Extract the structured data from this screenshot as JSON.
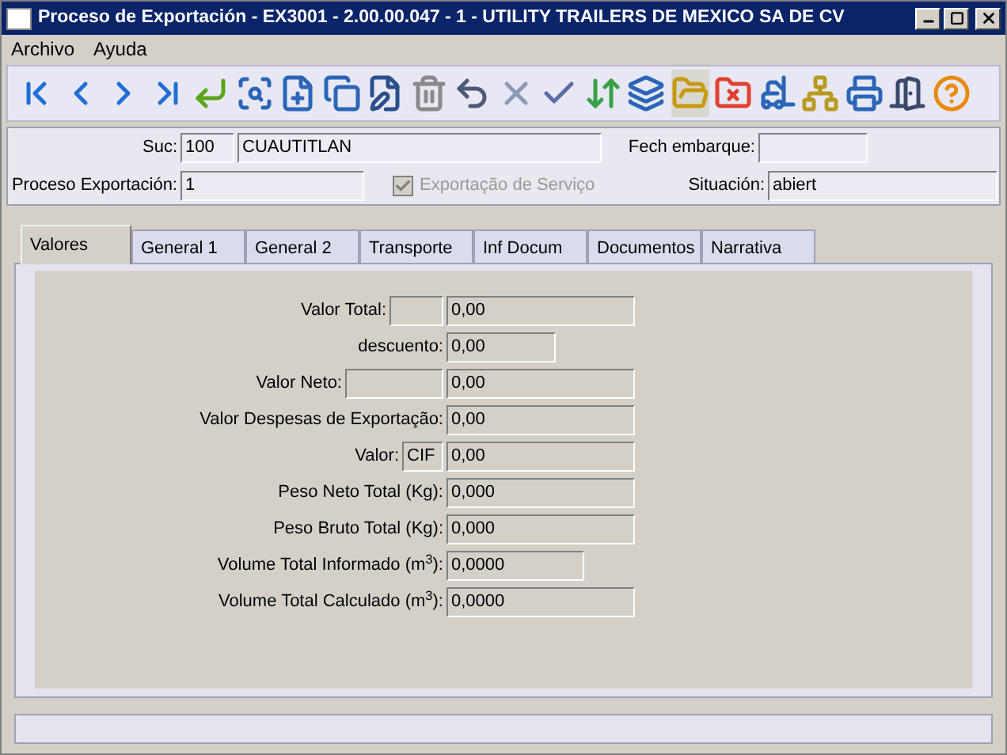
{
  "window": {
    "title": "Proceso de Exportación - EX3001 - 2.00.00.047 - 1 - UTILITY TRAILERS DE MEXICO SA DE CV"
  },
  "menu": [
    "Archivo",
    "Ayuda"
  ],
  "toolbar": [
    {
      "kind": "first",
      "selected": false
    },
    {
      "kind": "prev",
      "selected": false
    },
    {
      "kind": "next",
      "selected": false
    },
    {
      "kind": "last",
      "selected": false
    },
    {
      "kind": "enter",
      "selected": false
    },
    {
      "kind": "preview",
      "selected": false
    },
    {
      "kind": "new",
      "selected": false
    },
    {
      "kind": "copy",
      "selected": false
    },
    {
      "kind": "edit",
      "selected": false
    },
    {
      "kind": "delete",
      "selected": false
    },
    {
      "kind": "undo",
      "selected": false
    },
    {
      "kind": "cancel",
      "selected": false
    },
    {
      "kind": "confirm",
      "selected": false
    },
    {
      "kind": "swap",
      "selected": false
    },
    {
      "kind": "layers",
      "selected": false
    },
    {
      "kind": "open",
      "selected": true
    },
    {
      "kind": "folder-remove",
      "selected": false
    },
    {
      "kind": "forklift",
      "selected": false
    },
    {
      "kind": "tree",
      "selected": false
    },
    {
      "kind": "print",
      "selected": false
    },
    {
      "kind": "exit",
      "selected": false
    },
    {
      "kind": "help",
      "selected": false
    }
  ],
  "header": {
    "suc_label": "Suc:",
    "suc_code": "100",
    "suc_name": "CUAUTITLAN",
    "fech_label": "Fech embarque:",
    "proceso_label": "Proceso Exportación:",
    "proceso_value": "1",
    "servicio": {
      "label": "Exportação de Serviço",
      "checked": true,
      "disabled": true
    },
    "situacion_label": "Situación:",
    "situacion_value": "abiert"
  },
  "tabs": [
    {
      "label": "Valores",
      "selected": true
    },
    {
      "label": "General 1",
      "selected": false
    },
    {
      "label": "General 2",
      "selected": false
    },
    {
      "label": "Transporte",
      "selected": false
    },
    {
      "label": "Inf Docum",
      "selected": false
    },
    {
      "label": "Documentos",
      "selected": false
    },
    {
      "label": "Narrativa",
      "selected": false
    }
  ],
  "valores": [
    {
      "label": "Valor Total:",
      "kind": "boxed",
      "value": "0,00"
    },
    {
      "label": "descuento:",
      "kind": "short",
      "value": "0,00"
    },
    {
      "label": "Valor Neto:",
      "kind": "boxed-wide",
      "value": "0,00"
    },
    {
      "label": "Valor Despesas de Exportação:",
      "kind": "long",
      "value": "0,00"
    },
    {
      "label": "Valor:",
      "kind": "coded",
      "code": "CIF",
      "value": "0,00"
    },
    {
      "label": "Peso Neto Total (Kg):",
      "kind": "long",
      "value": "0,000"
    },
    {
      "label": "Peso Bruto Total (Kg):",
      "kind": "long",
      "value": "0,000"
    },
    {
      "label": "Volume Total Informado (m$^{3}$):",
      "kind": "medium",
      "value": "0,0000"
    },
    {
      "label": "Volume Total Calculado (m$^{3}$):",
      "kind": "long",
      "value": "0,0000"
    }
  ]
}
